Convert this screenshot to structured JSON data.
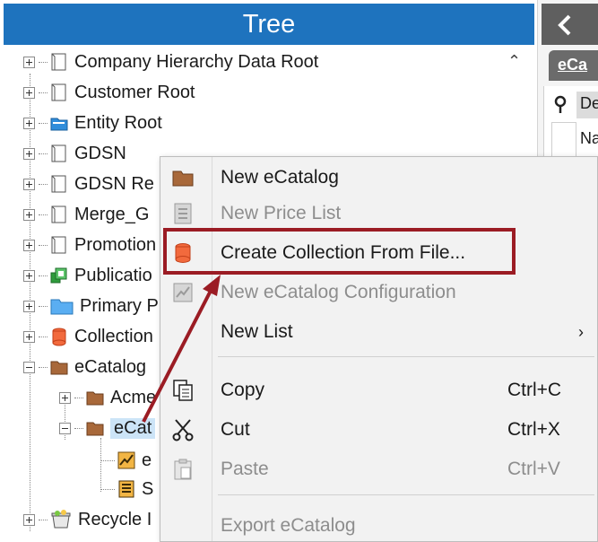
{
  "tree": {
    "title": "Tree",
    "items": [
      {
        "label": "Company Hierarchy Data Root",
        "icon": "page-icon"
      },
      {
        "label": "Customer Root",
        "icon": "page-icon"
      },
      {
        "label": "Entity Root",
        "icon": "blue-folder-icon"
      },
      {
        "label": "GDSN",
        "icon": "page-icon"
      },
      {
        "label": "GDSN Re",
        "icon": "page-icon"
      },
      {
        "label": "Merge_G",
        "icon": "page-icon"
      },
      {
        "label": "Promotion",
        "icon": "page-icon"
      },
      {
        "label": "Publicatio",
        "icon": "green-publication-icon"
      },
      {
        "label": "Primary P",
        "icon": "blue-folder-icon"
      },
      {
        "label": "Collection",
        "icon": "orange-collection-icon"
      },
      {
        "label": "eCatalog",
        "icon": "brown-folder-icon"
      },
      {
        "label": "Acme",
        "icon": "brown-folder-icon"
      },
      {
        "label": "eCat",
        "icon": "brown-folder-icon"
      },
      {
        "label": "e",
        "icon": "ecatalog-config-icon"
      },
      {
        "label": "S",
        "icon": "price-list-icon"
      },
      {
        "label": "Recycle I",
        "icon": "recycle-bin-icon"
      }
    ]
  },
  "right_panel": {
    "tab_label": "eCa",
    "header_cell": "De",
    "cell_text": "Na"
  },
  "context_menu": {
    "items": [
      {
        "label": "New eCatalog",
        "icon": "brown-folder-icon",
        "enabled": true
      },
      {
        "label": "New Price List",
        "icon": "price-list-icon",
        "enabled": false
      },
      {
        "label": "Create Collection From File...",
        "icon": "orange-collection-icon",
        "enabled": true
      },
      {
        "label": "New eCatalog Configuration",
        "icon": "ecatalog-config-icon",
        "enabled": false
      },
      {
        "label": "New List",
        "submenu_arrow": "›",
        "enabled": true
      },
      {
        "label": "Copy",
        "shortcut": "Ctrl+C",
        "icon": "copy-icon",
        "enabled": true
      },
      {
        "label": "Cut",
        "shortcut": "Ctrl+X",
        "icon": "scissors-icon",
        "enabled": true
      },
      {
        "label": "Paste",
        "shortcut": "Ctrl+V",
        "icon": "paste-icon",
        "enabled": false
      },
      {
        "label": "Export eCatalog",
        "enabled": false
      }
    ]
  },
  "colors": {
    "tree_header": "#1e73be",
    "highlight": "#9b1c24",
    "disabled_text": "#8d8d8d"
  }
}
